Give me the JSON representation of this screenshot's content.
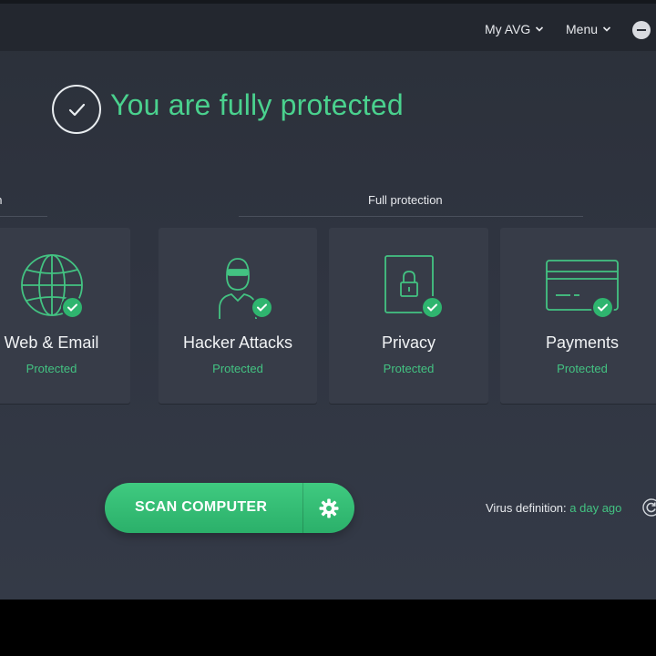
{
  "topbar": {
    "my_avg_label": "My AVG",
    "menu_label": "Menu"
  },
  "status": {
    "title": "You are fully protected"
  },
  "sections": {
    "left_label_fragment": "on",
    "full_label": "Full protection"
  },
  "cards": [
    {
      "title": "Web & Email",
      "status": "Protected",
      "icon": "globe-icon"
    },
    {
      "title": "Hacker Attacks",
      "status": "Protected",
      "icon": "hacker-icon"
    },
    {
      "title": "Privacy",
      "status": "Protected",
      "icon": "lock-icon"
    },
    {
      "title": "Payments",
      "status": "Protected",
      "icon": "credit-card-icon"
    }
  ],
  "scan": {
    "label": "SCAN COMPUTER"
  },
  "virus_definition": {
    "label": "Virus definition:",
    "value": "a day ago"
  },
  "colors": {
    "accent": "#43c382",
    "status_green": "#4ad18e",
    "background": "#2f3440",
    "card": "#373c48"
  }
}
